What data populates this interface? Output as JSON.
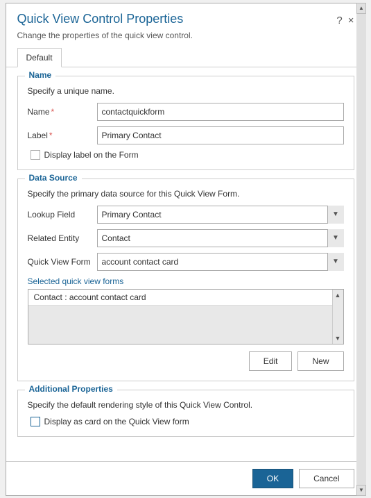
{
  "dialog": {
    "title": "Quick View Control Properties",
    "subtitle": "Change the properties of the quick view control.",
    "help_icon": "?",
    "close_icon": "×"
  },
  "tabs": [
    {
      "label": "Default",
      "active": true
    }
  ],
  "name_section": {
    "legend": "Name",
    "description": "Specify a unique name.",
    "name_label": "Name",
    "name_required": "*",
    "name_value": "contactquickform",
    "label_label": "Label",
    "label_required": "*",
    "label_value": "Primary Contact",
    "checkbox_label": "Display label on the Form"
  },
  "data_source_section": {
    "legend": "Data Source",
    "description": "Specify the primary data source for this Quick View Form.",
    "lookup_label": "Lookup Field",
    "lookup_value": "Primary Contact",
    "related_entity_label": "Related Entity",
    "related_entity_value": "Contact",
    "quick_view_form_label": "Quick View Form",
    "quick_view_form_value": "account contact card",
    "selected_label": "Selected quick view forms",
    "list_item": "Contact : account contact card",
    "edit_btn": "Edit",
    "new_btn": "New"
  },
  "additional_section": {
    "legend": "Additional Properties",
    "description": "Specify the default rendering style of this Quick View Control.",
    "checkbox_label": "Display as card on the Quick View form"
  },
  "footer": {
    "ok_btn": "OK",
    "cancel_btn": "Cancel"
  }
}
